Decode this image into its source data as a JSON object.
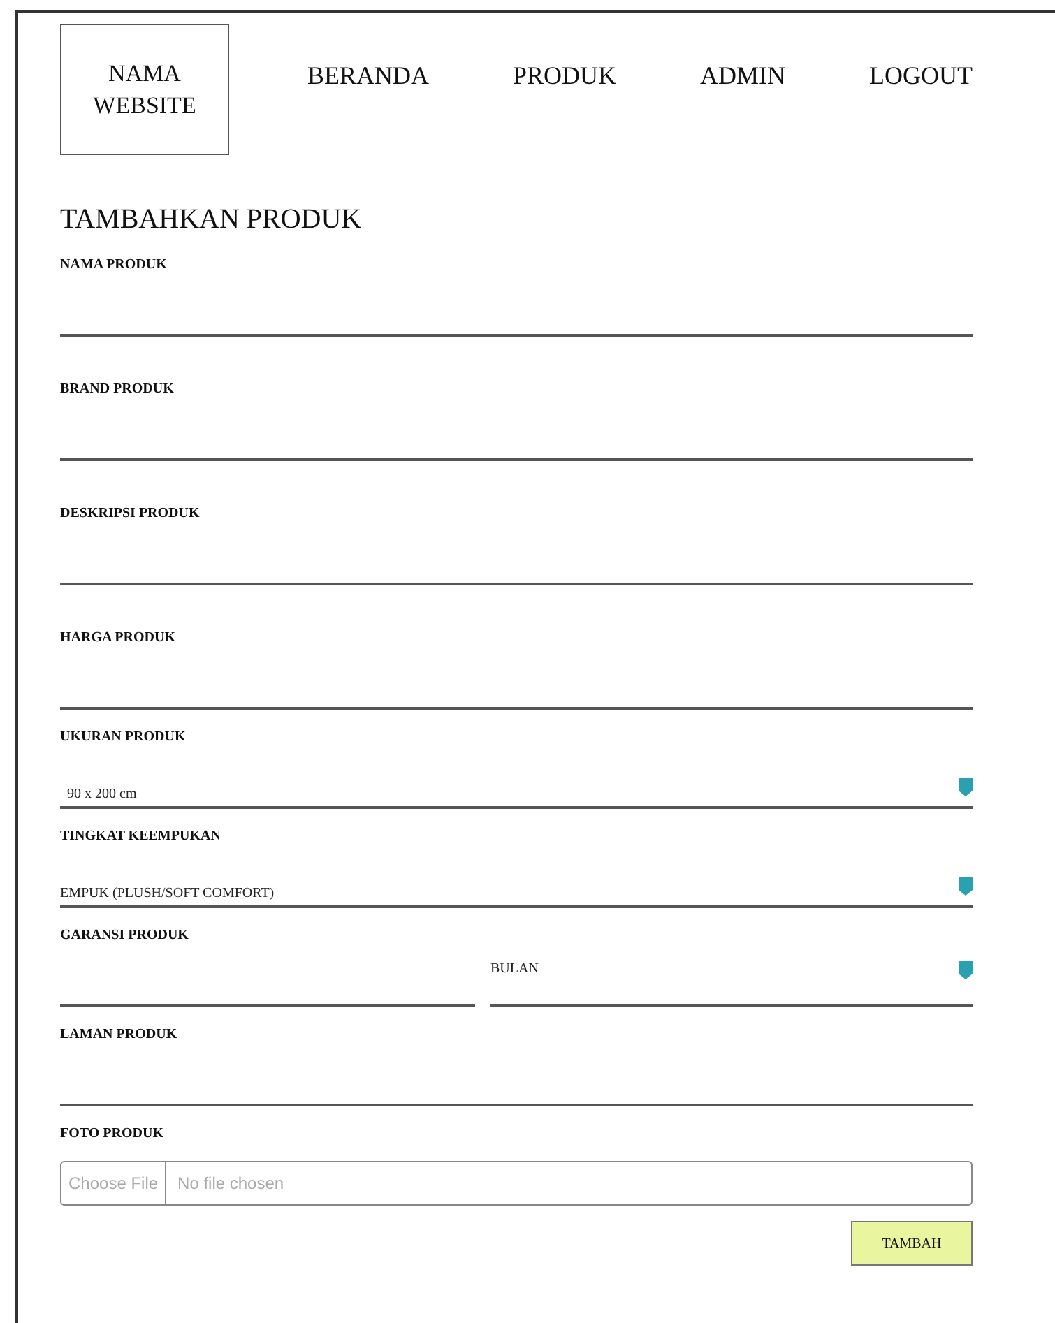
{
  "header": {
    "logo": "NAMA WEBSITE",
    "nav": [
      "BERANDA",
      "PRODUK",
      "ADMIN",
      "LOGOUT"
    ]
  },
  "title": "TAMBAHKAN PRODUK",
  "fields": [
    {
      "kind": "text",
      "label": "NAMA PRODUK"
    },
    {
      "kind": "text",
      "label": "BRAND PRODUK"
    },
    {
      "kind": "text",
      "label": "DESKRIPSI PRODUK"
    },
    {
      "kind": "text",
      "label": "HARGA PRODUK"
    },
    {
      "kind": "select",
      "label": "UKURAN PRODUK",
      "value": "90 x 200 cm"
    },
    {
      "kind": "select",
      "label": "TINGKAT KEEMPUKAN",
      "value": "EMPUK (PLUSH/SOFT COMFORT)"
    },
    {
      "kind": "split",
      "label": "GARANSI PRODUK",
      "unit": "BULAN"
    },
    {
      "kind": "text",
      "label": "LAMAN PRODUK"
    },
    {
      "kind": "file",
      "label": "FOTO PRODUK",
      "button": "Choose File",
      "status": "No file chosen"
    }
  ],
  "submit": "TAMBAH"
}
